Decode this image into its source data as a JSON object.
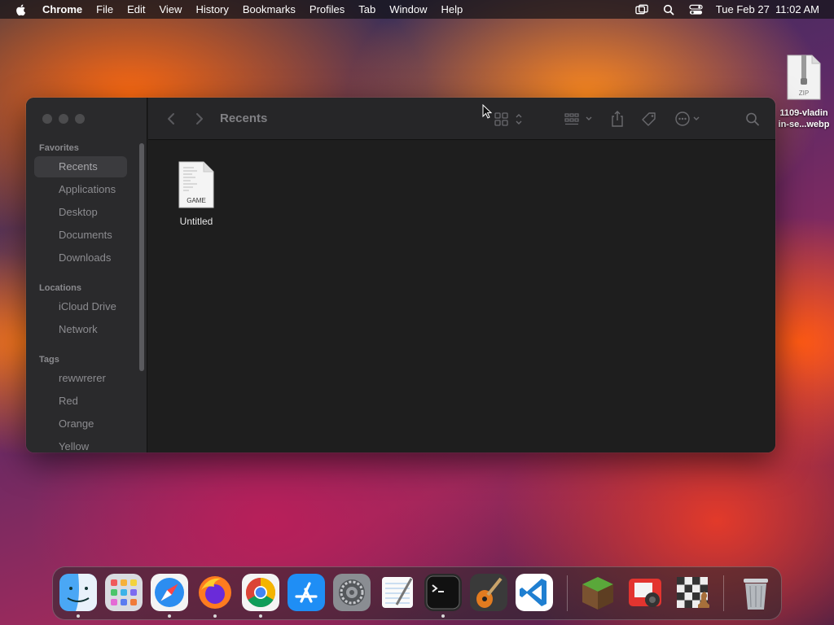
{
  "menubar": {
    "app_name": "Chrome",
    "items": [
      "File",
      "Edit",
      "View",
      "History",
      "Bookmarks",
      "Profiles",
      "Tab",
      "Window",
      "Help"
    ],
    "clock": "Tue Feb 27  11:02 AM",
    "icons": [
      "apple-logo",
      "screen-mirroring-icon",
      "spotlight-search-icon",
      "control-center-icon"
    ]
  },
  "desktop": {
    "file": {
      "badge": "ZIP",
      "label_line1": "1109-vladin",
      "label_line2": "in-se...webp"
    }
  },
  "finder": {
    "title": "Recents",
    "sidebar": {
      "favorites_header": "Favorites",
      "favorites": [
        "Recents",
        "Applications",
        "Desktop",
        "Documents",
        "Downloads"
      ],
      "locations_header": "Locations",
      "locations": [
        "iCloud Drive",
        "Network"
      ],
      "tags_header": "Tags",
      "tags": [
        "rewwrerer",
        "Red",
        "Orange",
        "Yellow"
      ]
    },
    "files": [
      {
        "name": "Untitled",
        "badge": "GAME"
      }
    ]
  },
  "dock": {
    "apps": [
      "Finder",
      "Launchpad",
      "Safari",
      "Firefox",
      "Google Chrome",
      "App Store",
      "System Settings",
      "TextEdit",
      "Terminal",
      "GarageBand",
      "Visual Studio Code",
      "Minecraft",
      "Photo Booth",
      "Chess",
      "Trash"
    ]
  },
  "colors": {
    "window_bg": "#1e1e1e",
    "sidebar_bg": "#2a2a2c",
    "selected_item": "#3b3b3e"
  }
}
